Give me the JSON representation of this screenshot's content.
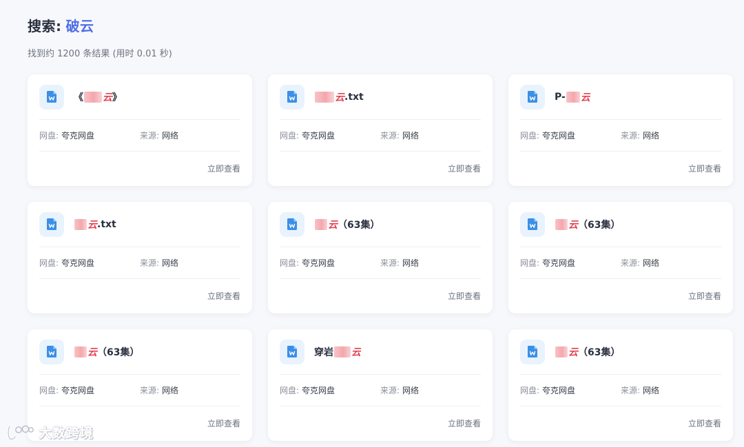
{
  "search": {
    "label": "搜索:",
    "query": "破云",
    "result_summary": "找到约 1200 条结果 (用时 0.01 秒)"
  },
  "colors": {
    "accent": "#4f6ee8",
    "highlight": "#e1404f",
    "doc_icon": "#3b8fe6"
  },
  "results": [
    {
      "title_prefix": "《",
      "masked": true,
      "masked_width": 26,
      "title_key": "云",
      "title_suffix": "》",
      "icon": "word-doc-icon",
      "disk_label": "网盘:",
      "disk": "夸克网盘",
      "source_label": "来源:",
      "source": "网络",
      "action": "立即查看"
    },
    {
      "title_prefix": "",
      "masked": true,
      "masked_width": 28,
      "title_key": "云",
      "title_suffix": ".txt",
      "icon": "word-doc-icon",
      "disk_label": "网盘:",
      "disk": "夸克网盘",
      "source_label": "来源:",
      "source": "网络",
      "action": "立即查看"
    },
    {
      "title_prefix": "P-",
      "masked": true,
      "masked_width": 20,
      "title_key": "云",
      "title_suffix": "",
      "icon": "word-doc-icon",
      "disk_label": "网盘:",
      "disk": "夸克网盘",
      "source_label": "来源:",
      "source": "网络",
      "action": "立即查看"
    },
    {
      "title_prefix": "",
      "masked": true,
      "masked_width": 14,
      "title_key": "云",
      "title_suffix": ".txt",
      "icon": "word-doc-icon",
      "disk_label": "网盘:",
      "disk": "夸克网盘",
      "source_label": "来源:",
      "source": "网络",
      "action": "立即查看"
    },
    {
      "title_prefix": "",
      "masked": true,
      "masked_width": 16,
      "title_key": "云",
      "title_suffix": "（63集）",
      "icon": "word-doc-icon",
      "disk_label": "网盘:",
      "disk": "夸克网盘",
      "source_label": "来源:",
      "source": "网络",
      "action": "立即查看"
    },
    {
      "title_prefix": "",
      "masked": true,
      "masked_width": 16,
      "title_key": "云",
      "title_suffix": "（63集）",
      "icon": "word-doc-icon",
      "disk_label": "网盘:",
      "disk": "夸克网盘",
      "source_label": "来源:",
      "source": "网络",
      "action": "立即查看"
    },
    {
      "title_prefix": "",
      "masked": true,
      "masked_width": 18,
      "title_key": "云",
      "title_suffix": "（63集）",
      "icon": "word-doc-icon",
      "disk_label": "网盘:",
      "disk": "夸克网盘",
      "source_label": "来源:",
      "source": "网络",
      "action": "立即查看"
    },
    {
      "title_prefix": "穿岩",
      "masked": true,
      "masked_width": 24,
      "title_key": "云",
      "title_suffix": "",
      "icon": "word-doc-icon",
      "disk_label": "网盘:",
      "disk": "夸克网盘",
      "source_label": "来源:",
      "source": "网络",
      "action": "立即查看"
    },
    {
      "title_prefix": "",
      "masked": true,
      "masked_width": 16,
      "title_key": "云",
      "title_suffix": "（63集）",
      "icon": "word-doc-icon",
      "disk_label": "网盘:",
      "disk": "夸克网盘",
      "source_label": "来源:",
      "source": "网络",
      "action": "立即查看"
    }
  ],
  "watermark": {
    "text": "大数跨境",
    "logo": "watermark-logo-icon"
  }
}
